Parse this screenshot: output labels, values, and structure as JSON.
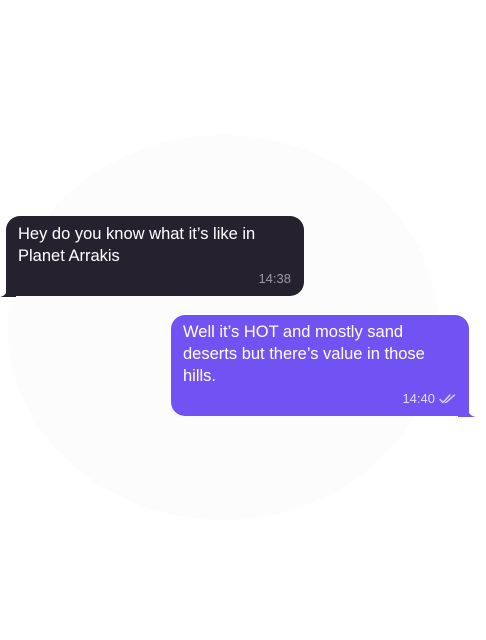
{
  "messages": [
    {
      "direction": "incoming",
      "text": "Hey do you know what it’s like in Planet Arrakis",
      "time": "14:38"
    },
    {
      "direction": "outgoing",
      "text": "Well it’s HOT and mostly sand deserts but there’s value in those hills.",
      "time": "14:40",
      "status_icon": "double-check-icon"
    }
  ],
  "colors": {
    "incoming_bubble": "#25212f",
    "outgoing_bubble": "#7152f3",
    "background": "#ffffff"
  }
}
